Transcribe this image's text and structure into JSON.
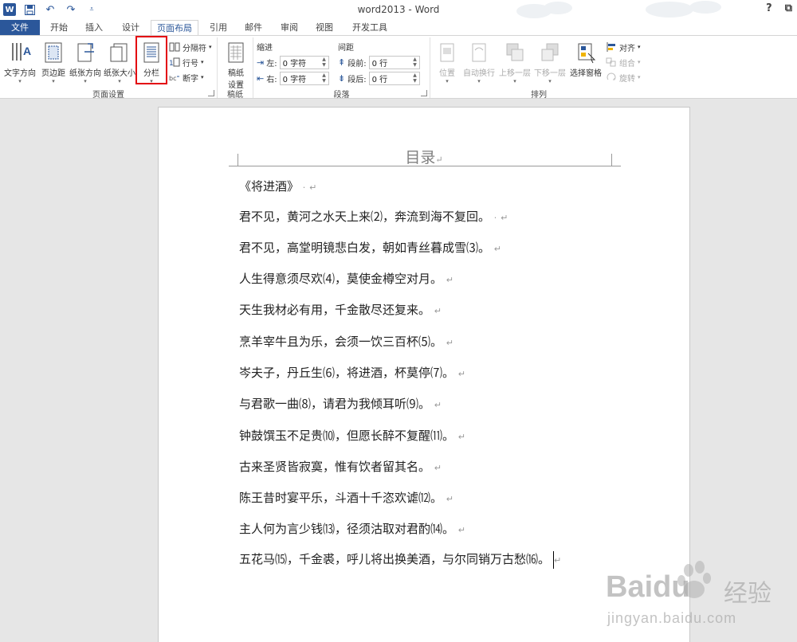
{
  "window": {
    "title": "word2013 - Word",
    "help": "?",
    "restore": "⧉"
  },
  "tabs": [
    "文件",
    "开始",
    "插入",
    "设计",
    "页面布局",
    "引用",
    "邮件",
    "审阅",
    "视图",
    "开发工具"
  ],
  "ribbon": {
    "page_setup": {
      "label": "页面设置",
      "text_direction": "文字方向",
      "margins": "页边距",
      "orientation": "纸张方向",
      "size": "纸张大小",
      "columns": "分栏",
      "breaks": "分隔符",
      "line_numbers": "行号",
      "hyphenation": "断字"
    },
    "manuscript": {
      "label": "稿纸",
      "button_line1": "稿纸",
      "button_line2": "设置"
    },
    "paragraph": {
      "label": "段落",
      "indent_header": "缩进",
      "spacing_header": "间距",
      "left_label": "左:",
      "left_value": "0 字符",
      "right_label": "右:",
      "right_value": "0 字符",
      "before_label": "段前:",
      "before_value": "0 行",
      "after_label": "段后:",
      "after_value": "0 行"
    },
    "arrange": {
      "label": "排列",
      "position": "位置",
      "wrap_text": "自动换行",
      "bring_forward": "上移一层",
      "send_backward": "下移一层",
      "selection_pane": "选择窗格",
      "align": "对齐",
      "group": "组合",
      "rotate": "旋转"
    }
  },
  "document": {
    "toc_title": "目录",
    "lines": [
      "《将进酒》",
      "君不见，黄河之水天上来⑵，奔流到海不复回。",
      "君不见，高堂明镜悲白发，朝如青丝暮成雪⑶。",
      "人生得意须尽欢⑷，莫使金樽空对月。",
      "天生我材必有用，千金散尽还复来。",
      "烹羊宰牛且为乐，会须一饮三百杯⑸。",
      "岑夫子，丹丘生⑹，将进酒，杯莫停⑺。",
      "与君歌一曲⑻，请君为我倾耳听⑼。",
      "钟鼓馔玉不足贵⑽，但愿长醉不复醒⑾。",
      "古来圣贤皆寂寞，惟有饮者留其名。",
      "陈王昔时宴平乐，斗酒十千恣欢谑⑿。",
      "主人何为言少钱⒀，径须沽取对君酌⒁。",
      "五花马⒂，千金裘，呼儿将出换美酒，与尔同销万古愁⒃。"
    ],
    "pilcrow": "↵",
    "dot": "·"
  },
  "watermark": {
    "brand": "Baidu",
    "cn": "经验",
    "url": "jingyan.baidu.com"
  }
}
